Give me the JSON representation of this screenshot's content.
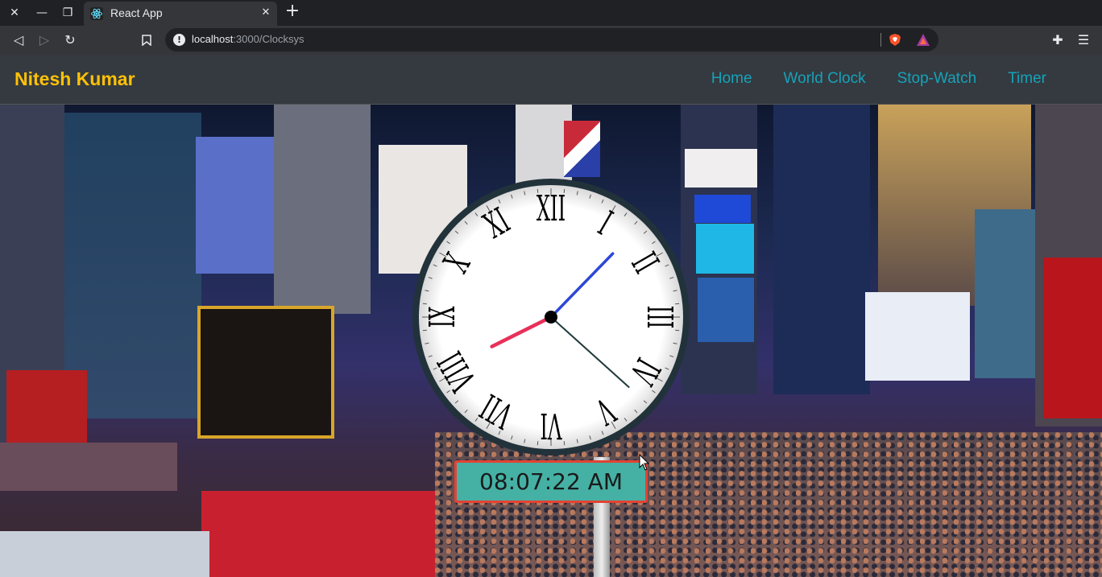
{
  "browser": {
    "tab_title": "React App",
    "url_host": "localhost",
    "url_path": ":3000/Clocksys",
    "icons": [
      "close-icon",
      "minimize-icon",
      "restore-icon",
      "react-icon",
      "tab-close-icon",
      "new-tab-icon",
      "back-icon",
      "forward-icon",
      "reload-icon",
      "bookmark-icon",
      "info-icon",
      "brave-shields-icon",
      "brave-rewards-icon",
      "extensions-icon",
      "menu-icon"
    ]
  },
  "navbar": {
    "brand": "Nitesh Kumar",
    "links": [
      "Home",
      "World Clock",
      "Stop-Watch",
      "Timer"
    ],
    "brand_color": "#ffc107",
    "link_color": "#17a2b8"
  },
  "clock": {
    "numerals": [
      "XII",
      "I",
      "II",
      "III",
      "IV",
      "V",
      "VI",
      "VII",
      "VIII",
      "IX",
      "X",
      "XI"
    ],
    "hours": 8,
    "minutes": 7,
    "seconds": 22,
    "digital_time": "08:07:22 AM",
    "hour_hand_color": "#e8305a",
    "minute_hand_color": "#2d47d6",
    "second_hand_color": "#1f3a3a"
  }
}
